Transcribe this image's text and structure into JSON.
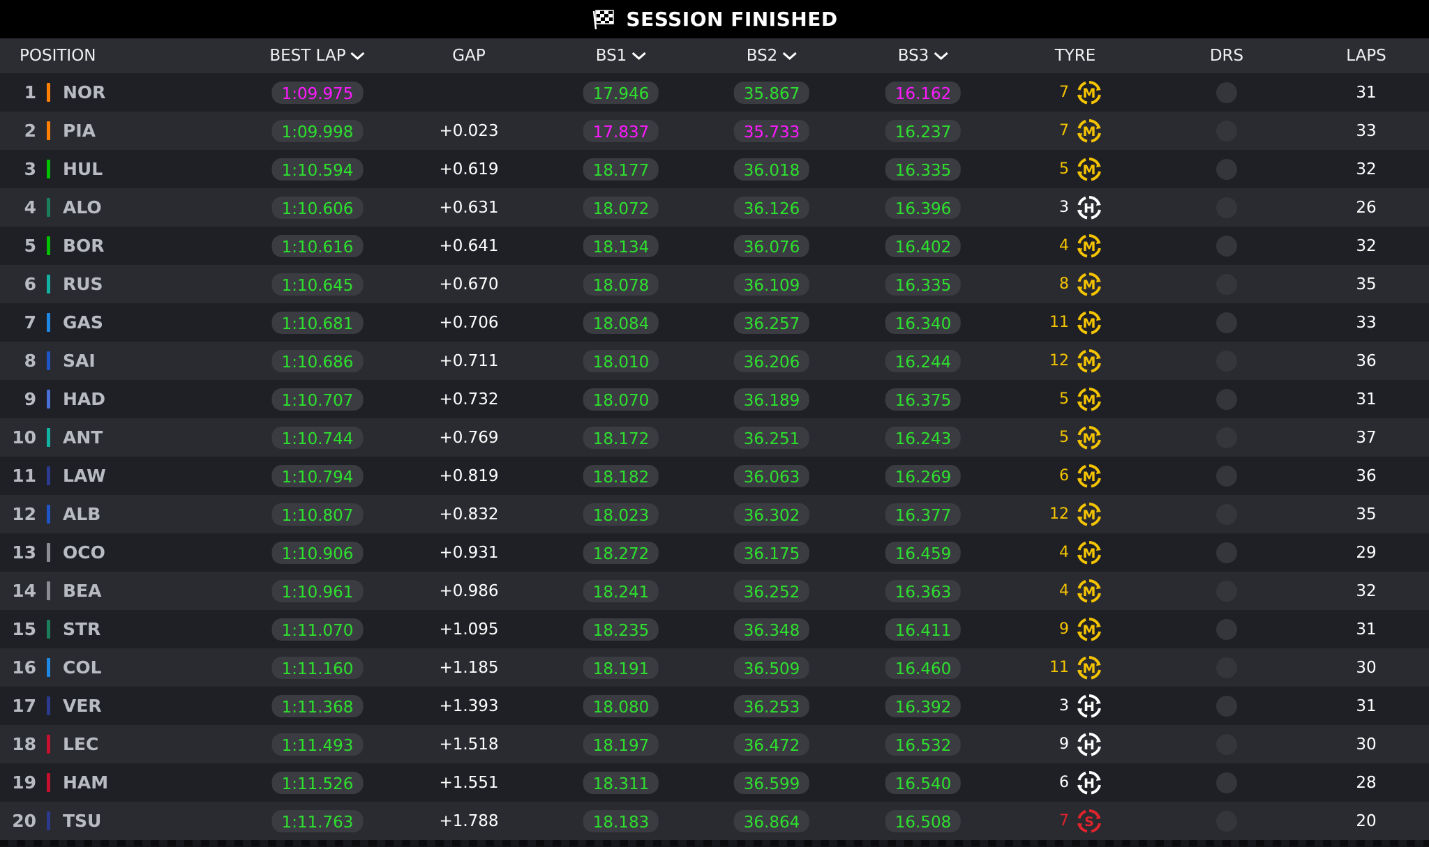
{
  "title": "SESSION FINISHED",
  "colors": {
    "green": "#2ee02e",
    "purple": "#ff1aff",
    "medium": "#f5c400",
    "hard": "#ffffff",
    "soft": "#e0242c"
  },
  "headers": {
    "position": "POSITION",
    "best_lap": "BEST LAP",
    "gap": "GAP",
    "bs1": "BS1",
    "bs2": "BS2",
    "bs3": "BS3",
    "tyre": "TYRE",
    "drs": "DRS",
    "laps": "LAPS"
  },
  "rows": [
    {
      "pos": "1",
      "driver": "NOR",
      "team_color": "#ff8000",
      "best": "1:09.975",
      "best_style": "purple",
      "gap": "",
      "bs1": "17.946",
      "bs1_style": "green",
      "bs2": "35.867",
      "bs2_style": "green",
      "bs3": "16.162",
      "bs3_style": "purple",
      "tyre_laps": "7",
      "tyre": "M",
      "tyre_color": "#f5c400",
      "laps": "31"
    },
    {
      "pos": "2",
      "driver": "PIA",
      "team_color": "#ff8000",
      "best": "1:09.998",
      "best_style": "green",
      "gap": "+0.023",
      "bs1": "17.837",
      "bs1_style": "purple",
      "bs2": "35.733",
      "bs2_style": "purple",
      "bs3": "16.237",
      "bs3_style": "green",
      "tyre_laps": "7",
      "tyre": "M",
      "tyre_color": "#f5c400",
      "laps": "33"
    },
    {
      "pos": "3",
      "driver": "HUL",
      "team_color": "#00c000",
      "best": "1:10.594",
      "best_style": "green",
      "gap": "+0.619",
      "bs1": "18.177",
      "bs1_style": "green",
      "bs2": "36.018",
      "bs2_style": "green",
      "bs3": "16.335",
      "bs3_style": "green",
      "tyre_laps": "5",
      "tyre": "M",
      "tyre_color": "#f5c400",
      "laps": "32"
    },
    {
      "pos": "4",
      "driver": "ALO",
      "team_color": "#1a7f5a",
      "best": "1:10.606",
      "best_style": "green",
      "gap": "+0.631",
      "bs1": "18.072",
      "bs1_style": "green",
      "bs2": "36.126",
      "bs2_style": "green",
      "bs3": "16.396",
      "bs3_style": "green",
      "tyre_laps": "3",
      "tyre": "H",
      "tyre_color": "#ffffff",
      "laps": "26"
    },
    {
      "pos": "5",
      "driver": "BOR",
      "team_color": "#00c000",
      "best": "1:10.616",
      "best_style": "green",
      "gap": "+0.641",
      "bs1": "18.134",
      "bs1_style": "green",
      "bs2": "36.076",
      "bs2_style": "green",
      "bs3": "16.402",
      "bs3_style": "green",
      "tyre_laps": "4",
      "tyre": "M",
      "tyre_color": "#f5c400",
      "laps": "32"
    },
    {
      "pos": "6",
      "driver": "RUS",
      "team_color": "#12b3a3",
      "best": "1:10.645",
      "best_style": "green",
      "gap": "+0.670",
      "bs1": "18.078",
      "bs1_style": "green",
      "bs2": "36.109",
      "bs2_style": "green",
      "bs3": "16.335",
      "bs3_style": "green",
      "tyre_laps": "8",
      "tyre": "M",
      "tyre_color": "#f5c400",
      "laps": "35"
    },
    {
      "pos": "7",
      "driver": "GAS",
      "team_color": "#1e88e5",
      "best": "1:10.681",
      "best_style": "green",
      "gap": "+0.706",
      "bs1": "18.084",
      "bs1_style": "green",
      "bs2": "36.257",
      "bs2_style": "green",
      "bs3": "16.340",
      "bs3_style": "green",
      "tyre_laps": "11",
      "tyre": "M",
      "tyre_color": "#f5c400",
      "laps": "33"
    },
    {
      "pos": "8",
      "driver": "SAI",
      "team_color": "#1e56c8",
      "best": "1:10.686",
      "best_style": "green",
      "gap": "+0.711",
      "bs1": "18.010",
      "bs1_style": "green",
      "bs2": "36.206",
      "bs2_style": "green",
      "bs3": "16.244",
      "bs3_style": "green",
      "tyre_laps": "12",
      "tyre": "M",
      "tyre_color": "#f5c400",
      "laps": "36"
    },
    {
      "pos": "9",
      "driver": "HAD",
      "team_color": "#4a6fd8",
      "best": "1:10.707",
      "best_style": "green",
      "gap": "+0.732",
      "bs1": "18.070",
      "bs1_style": "green",
      "bs2": "36.189",
      "bs2_style": "green",
      "bs3": "16.375",
      "bs3_style": "green",
      "tyre_laps": "5",
      "tyre": "M",
      "tyre_color": "#f5c400",
      "laps": "31"
    },
    {
      "pos": "10",
      "driver": "ANT",
      "team_color": "#12b3a3",
      "best": "1:10.744",
      "best_style": "green",
      "gap": "+0.769",
      "bs1": "18.172",
      "bs1_style": "green",
      "bs2": "36.251",
      "bs2_style": "green",
      "bs3": "16.243",
      "bs3_style": "green",
      "tyre_laps": "5",
      "tyre": "M",
      "tyre_color": "#f5c400",
      "laps": "37"
    },
    {
      "pos": "11",
      "driver": "LAW",
      "team_color": "#2b3a8f",
      "best": "1:10.794",
      "best_style": "green",
      "gap": "+0.819",
      "bs1": "18.182",
      "bs1_style": "green",
      "bs2": "36.063",
      "bs2_style": "green",
      "bs3": "16.269",
      "bs3_style": "green",
      "tyre_laps": "6",
      "tyre": "M",
      "tyre_color": "#f5c400",
      "laps": "36"
    },
    {
      "pos": "12",
      "driver": "ALB",
      "team_color": "#1e56c8",
      "best": "1:10.807",
      "best_style": "green",
      "gap": "+0.832",
      "bs1": "18.023",
      "bs1_style": "green",
      "bs2": "36.302",
      "bs2_style": "green",
      "bs3": "16.377",
      "bs3_style": "green",
      "tyre_laps": "12",
      "tyre": "M",
      "tyre_color": "#f5c400",
      "laps": "35"
    },
    {
      "pos": "13",
      "driver": "OCO",
      "team_color": "#8a8d94",
      "best": "1:10.906",
      "best_style": "green",
      "gap": "+0.931",
      "bs1": "18.272",
      "bs1_style": "green",
      "bs2": "36.175",
      "bs2_style": "green",
      "bs3": "16.459",
      "bs3_style": "green",
      "tyre_laps": "4",
      "tyre": "M",
      "tyre_color": "#f5c400",
      "laps": "29"
    },
    {
      "pos": "14",
      "driver": "BEA",
      "team_color": "#8a8d94",
      "best": "1:10.961",
      "best_style": "green",
      "gap": "+0.986",
      "bs1": "18.241",
      "bs1_style": "green",
      "bs2": "36.252",
      "bs2_style": "green",
      "bs3": "16.363",
      "bs3_style": "green",
      "tyre_laps": "4",
      "tyre": "M",
      "tyre_color": "#f5c400",
      "laps": "32"
    },
    {
      "pos": "15",
      "driver": "STR",
      "team_color": "#1a7f5a",
      "best": "1:11.070",
      "best_style": "green",
      "gap": "+1.095",
      "bs1": "18.235",
      "bs1_style": "green",
      "bs2": "36.348",
      "bs2_style": "green",
      "bs3": "16.411",
      "bs3_style": "green",
      "tyre_laps": "9",
      "tyre": "M",
      "tyre_color": "#f5c400",
      "laps": "31"
    },
    {
      "pos": "16",
      "driver": "COL",
      "team_color": "#1e88e5",
      "best": "1:11.160",
      "best_style": "green",
      "gap": "+1.185",
      "bs1": "18.191",
      "bs1_style": "green",
      "bs2": "36.509",
      "bs2_style": "green",
      "bs3": "16.460",
      "bs3_style": "green",
      "tyre_laps": "11",
      "tyre": "M",
      "tyre_color": "#f5c400",
      "laps": "30"
    },
    {
      "pos": "17",
      "driver": "VER",
      "team_color": "#2b3a8f",
      "best": "1:11.368",
      "best_style": "green",
      "gap": "+1.393",
      "bs1": "18.080",
      "bs1_style": "green",
      "bs2": "36.253",
      "bs2_style": "green",
      "bs3": "16.392",
      "bs3_style": "green",
      "tyre_laps": "3",
      "tyre": "H",
      "tyre_color": "#ffffff",
      "laps": "31"
    },
    {
      "pos": "18",
      "driver": "LEC",
      "team_color": "#c8102e",
      "best": "1:11.493",
      "best_style": "green",
      "gap": "+1.518",
      "bs1": "18.197",
      "bs1_style": "green",
      "bs2": "36.472",
      "bs2_style": "green",
      "bs3": "16.532",
      "bs3_style": "green",
      "tyre_laps": "9",
      "tyre": "H",
      "tyre_color": "#ffffff",
      "laps": "30"
    },
    {
      "pos": "19",
      "driver": "HAM",
      "team_color": "#c8102e",
      "best": "1:11.526",
      "best_style": "green",
      "gap": "+1.551",
      "bs1": "18.311",
      "bs1_style": "green",
      "bs2": "36.599",
      "bs2_style": "green",
      "bs3": "16.540",
      "bs3_style": "green",
      "tyre_laps": "6",
      "tyre": "H",
      "tyre_color": "#ffffff",
      "laps": "28"
    },
    {
      "pos": "20",
      "driver": "TSU",
      "team_color": "#2b3a8f",
      "best": "1:11.763",
      "best_style": "green",
      "gap": "+1.788",
      "bs1": "18.183",
      "bs1_style": "green",
      "bs2": "36.864",
      "bs2_style": "green",
      "bs3": "16.508",
      "bs3_style": "green",
      "tyre_laps": "7",
      "tyre": "S",
      "tyre_color": "#e0242c",
      "laps": "20"
    }
  ]
}
